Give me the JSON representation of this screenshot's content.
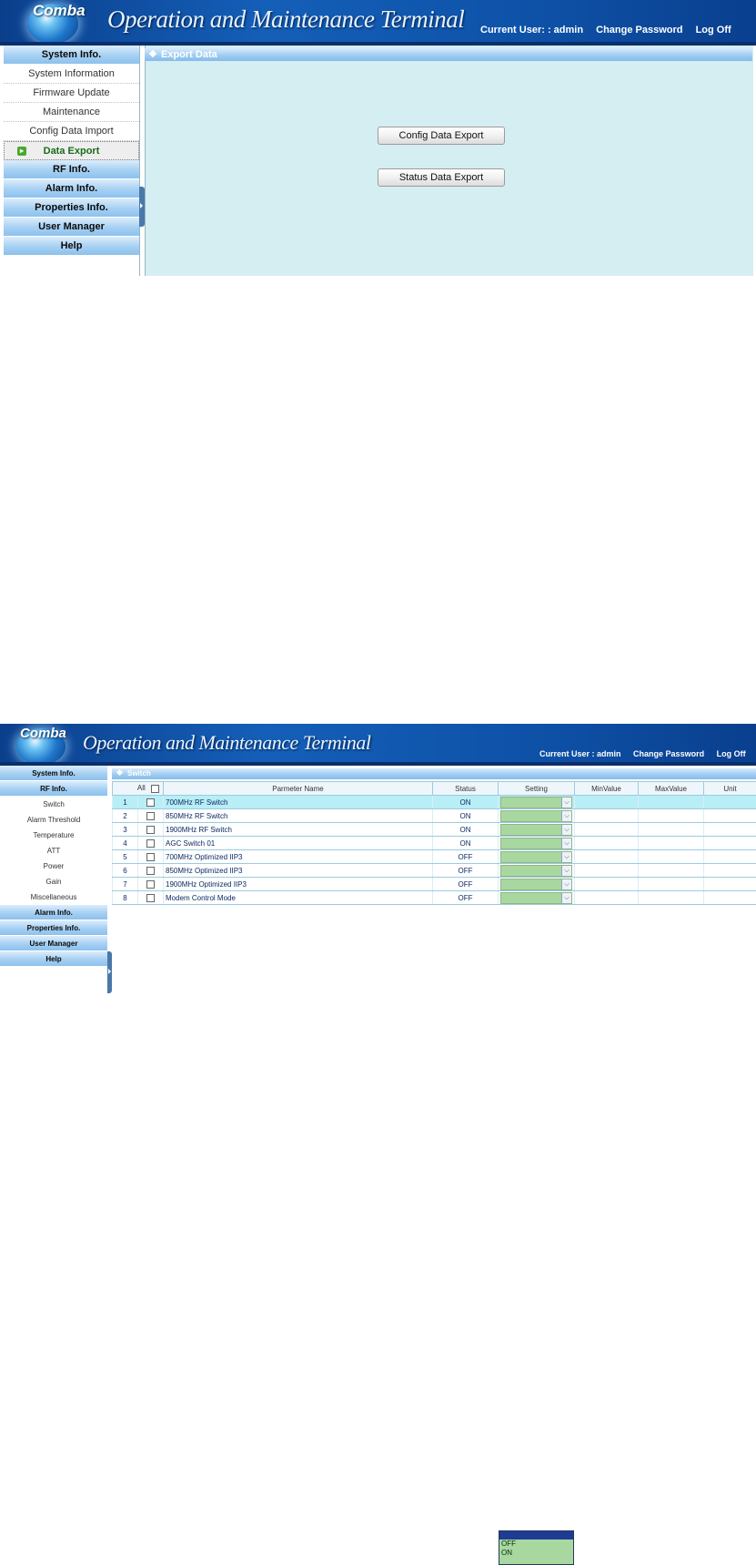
{
  "screen1": {
    "logo_text": "Comba",
    "app_title": "Operation and Maintenance Terminal",
    "current_user": "Current User: : admin",
    "change_password": "Change Password",
    "log_off": "Log Off",
    "section_title": "Export Data",
    "menu": [
      {
        "type": "head",
        "label": "System Info."
      },
      {
        "type": "item",
        "label": "System Information"
      },
      {
        "type": "item",
        "label": "Firmware Update"
      },
      {
        "type": "item",
        "label": "Maintenance"
      },
      {
        "type": "item",
        "label": "Config Data Import"
      },
      {
        "type": "item",
        "label": "Data Export",
        "active": true
      },
      {
        "type": "head",
        "label": "RF Info."
      },
      {
        "type": "head",
        "label": "Alarm Info."
      },
      {
        "type": "head",
        "label": "Properties Info."
      },
      {
        "type": "head",
        "label": "User Manager"
      },
      {
        "type": "head",
        "label": "Help"
      }
    ],
    "buttons": {
      "config_export": "Config Data Export",
      "status_export": "Status Data Export"
    },
    "colors": {
      "content_bg": "#d5eef2",
      "active_menu": "#1a6b1a"
    }
  },
  "screen2": {
    "logo_text": "Comba",
    "app_title": "Operation and Maintenance Terminal",
    "current_user": "Current User : admin",
    "change_password": "Change Password",
    "log_off": "Log Off",
    "section_title": "Switch",
    "menu": [
      {
        "type": "head",
        "label": "System Info."
      },
      {
        "type": "head",
        "label": "RF Info."
      },
      {
        "type": "item",
        "label": "Switch"
      },
      {
        "type": "item",
        "label": "Alarm Threshold"
      },
      {
        "type": "item",
        "label": "Temperature"
      },
      {
        "type": "item",
        "label": "ATT"
      },
      {
        "type": "item",
        "label": "Power"
      },
      {
        "type": "item",
        "label": "Gain"
      },
      {
        "type": "item",
        "label": "Miscellaneous"
      },
      {
        "type": "head",
        "label": "Alarm Info."
      },
      {
        "type": "head",
        "label": "Properties Info."
      },
      {
        "type": "head",
        "label": "User Manager"
      },
      {
        "type": "head",
        "label": "Help"
      }
    ],
    "table": {
      "columns": [
        "All",
        "Parmeter Name",
        "Status",
        "Setting",
        "MinValue",
        "MaxValue",
        "Unit"
      ],
      "rows": [
        {
          "no": "1",
          "name": "700MHz RF Switch",
          "status": "ON"
        },
        {
          "no": "2",
          "name": "850MHz RF Switch",
          "status": "ON"
        },
        {
          "no": "3",
          "name": "1900MHz RF Switch",
          "status": "ON"
        },
        {
          "no": "4",
          "name": "AGC Switch 01",
          "status": "ON"
        },
        {
          "no": "5",
          "name": "700MHz Optimized IIP3",
          "status": "OFF"
        },
        {
          "no": "6",
          "name": "850MHz Optimized IIP3",
          "status": "OFF"
        },
        {
          "no": "7",
          "name": "1900MHz Optimized IIP3",
          "status": "OFF"
        },
        {
          "no": "8",
          "name": "Modem Control Mode",
          "status": "OFF"
        }
      ],
      "highlighted_row": 0
    },
    "dropdown_options": [
      "",
      "OFF",
      "ON"
    ],
    "colors": {
      "row_highlight": "#b8eef6",
      "setting_bg": "#a8d8a0"
    }
  }
}
